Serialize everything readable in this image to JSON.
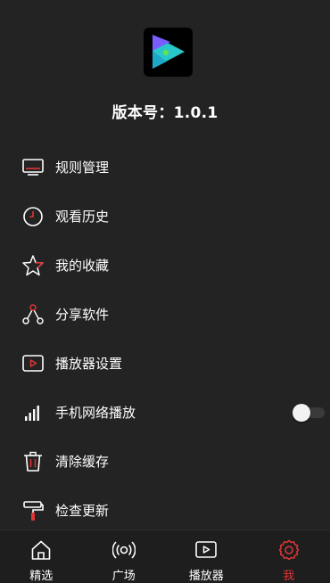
{
  "app": {
    "version_text": "版本号：1.0.1",
    "logo_icon": "app-play-logo-icon"
  },
  "colors": {
    "background": "#232323",
    "accent_red": "#e03535",
    "logo_bg": "#000000",
    "logo_purple": "#7a5cff",
    "logo_teal": "#28c8c8"
  },
  "menu": {
    "items": [
      {
        "label": "规则管理",
        "icon": "monitor-icon"
      },
      {
        "label": "观看历史",
        "icon": "clock-icon"
      },
      {
        "label": "我的收藏",
        "icon": "star-icon"
      },
      {
        "label": "分享软件",
        "icon": "share-icon"
      },
      {
        "label": "播放器设置",
        "icon": "player-settings-icon"
      },
      {
        "label": "手机网络播放",
        "icon": "signal-bars-icon",
        "toggle_on": false
      },
      {
        "label": "清除缓存",
        "icon": "trash-icon"
      },
      {
        "label": "检查更新",
        "icon": "paint-roller-icon"
      }
    ]
  },
  "nav": {
    "items": [
      {
        "label": "精选",
        "icon": "home-icon",
        "active": false
      },
      {
        "label": "广场",
        "icon": "broadcast-icon",
        "active": false
      },
      {
        "label": "播放器",
        "icon": "player-icon",
        "active": false
      },
      {
        "label": "我",
        "icon": "gear-icon",
        "active": true
      }
    ]
  }
}
